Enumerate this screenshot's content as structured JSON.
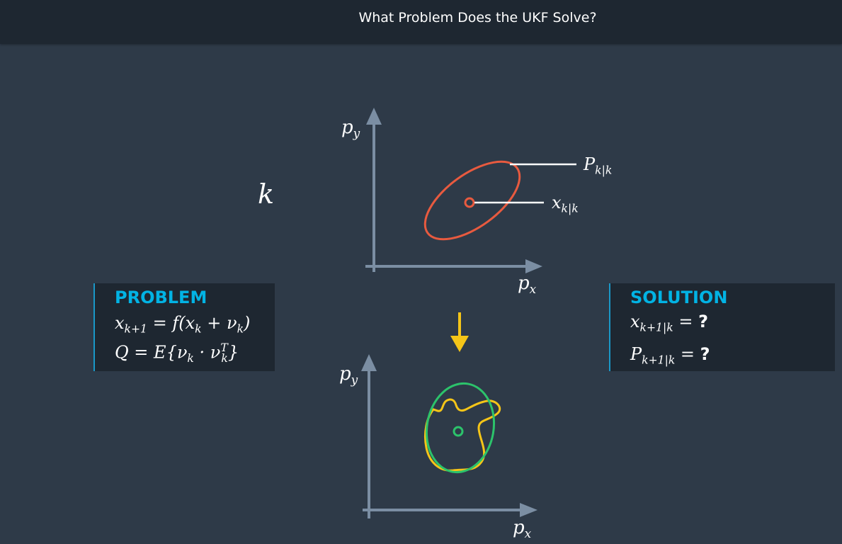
{
  "header": {
    "title": "What Problem Does the UKF Solve?"
  },
  "state_label": "k",
  "problem": {
    "heading": "PROBLEM",
    "eq1": {
      "lhs": "x",
      "lhs_sub": "k+1",
      "rest": " = f(x",
      "rest_sub": "k",
      "tail": " + ν",
      "tail_sub": "k",
      "end": ")"
    },
    "eq2": {
      "a": "Q = E{ν",
      "a_sub": "k",
      "b": " · ν",
      "b_sup": "T",
      "b_sub": "k",
      "end": "}"
    }
  },
  "solution": {
    "heading": "SOLUTION",
    "eq1": {
      "var": "x",
      "sub": "k+1|k",
      "eq": " = ",
      "q": "?"
    },
    "eq2": {
      "var": "P",
      "sub": "k+1|k",
      "eq": " = ",
      "q": "?"
    }
  },
  "top_plot": {
    "y_axis_label": "p",
    "y_axis_sub": "y",
    "x_axis_label": "p",
    "x_axis_sub": "x",
    "covariance_label": "P",
    "covariance_sub": "k|k",
    "mean_label": "x",
    "mean_sub": "k|k"
  },
  "bottom_plot": {
    "y_axis_label": "p",
    "y_axis_sub": "y",
    "x_axis_label": "p",
    "x_axis_sub": "x"
  },
  "colors": {
    "background": "#2e3a48",
    "header": "#1e2731",
    "axis": "#7b8ea3",
    "ellipse_prior": "#e85a3f",
    "ellipse_predicted": "#2cc36b",
    "true_distribution": "#f5c518",
    "arrow": "#f5c518",
    "heading_accent": "#02b3e4"
  },
  "icons": {
    "transition_arrow": "arrow-down-icon"
  }
}
